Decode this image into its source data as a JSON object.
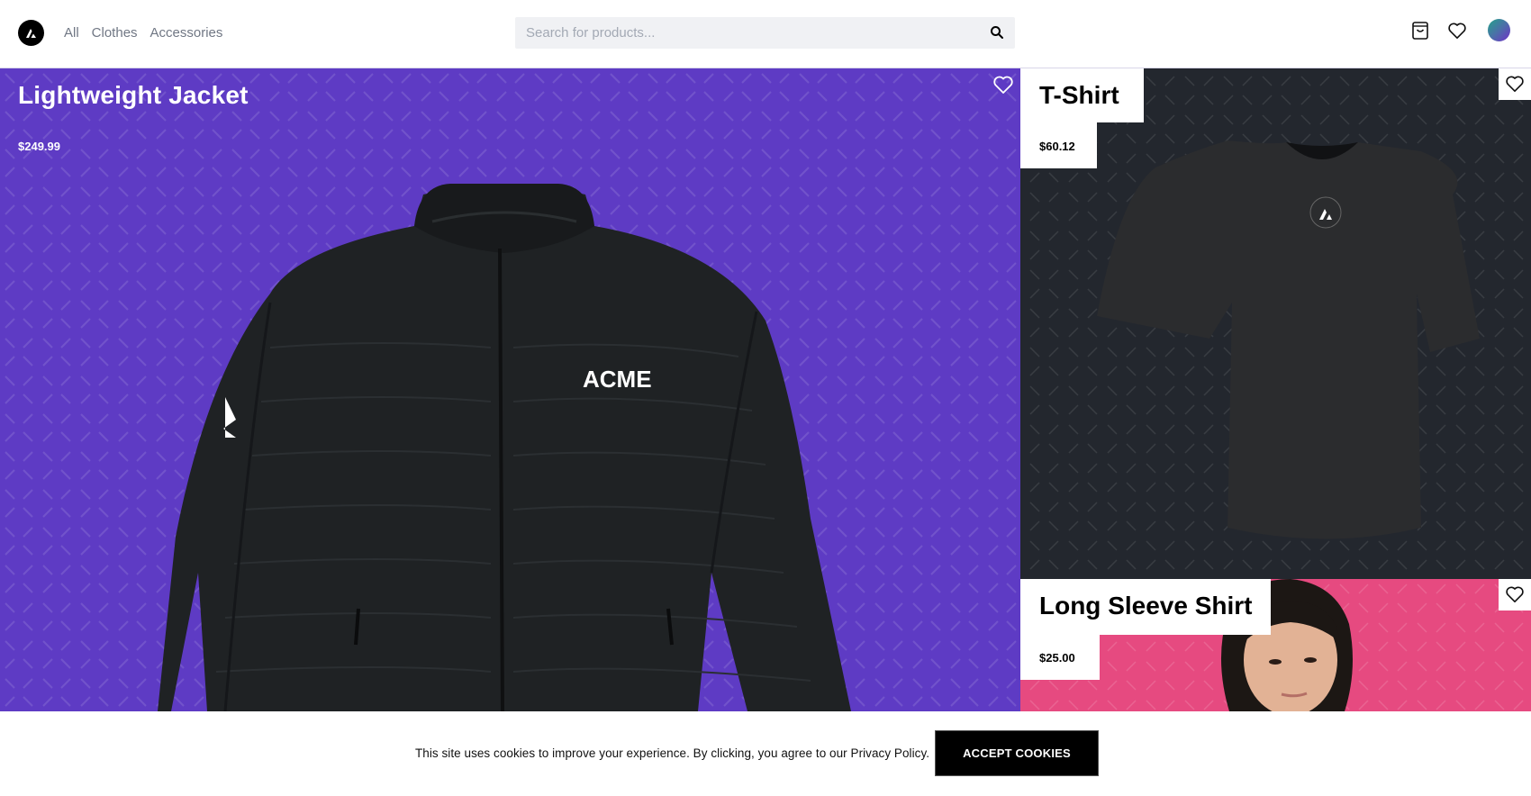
{
  "header": {
    "logo_icon": "acme-triangle-logo-icon",
    "nav": [
      {
        "label": "All"
      },
      {
        "label": "Clothes"
      },
      {
        "label": "Accessories"
      }
    ],
    "search": {
      "placeholder": "Search for products...",
      "value": "",
      "icon": "search-icon"
    },
    "icons": {
      "cart": "shopping-bag-icon",
      "wishlist": "heart-icon",
      "avatar": "user-avatar"
    }
  },
  "products": [
    {
      "title": "Lightweight Jacket",
      "price": "$249.99",
      "brand_text": "ACME",
      "background": "#5e3bc4",
      "favorite_icon": "heart-icon"
    },
    {
      "title": "T-Shirt",
      "price": "$60.12",
      "background": "#23272e",
      "favorite_icon": "heart-icon"
    },
    {
      "title": "Long Sleeve Shirt",
      "price": "$25.00",
      "background": "#e64a80",
      "favorite_icon": "heart-icon"
    }
  ],
  "cookie_banner": {
    "text": "This site uses cookies to improve your experience. By clicking, you agree to our Privacy Policy.",
    "button_label": "ACCEPT COOKIES"
  },
  "colors": {
    "accent_purple": "#5e3bc4",
    "dark": "#23272e",
    "pink": "#e64a80",
    "nav_text": "#707784"
  }
}
